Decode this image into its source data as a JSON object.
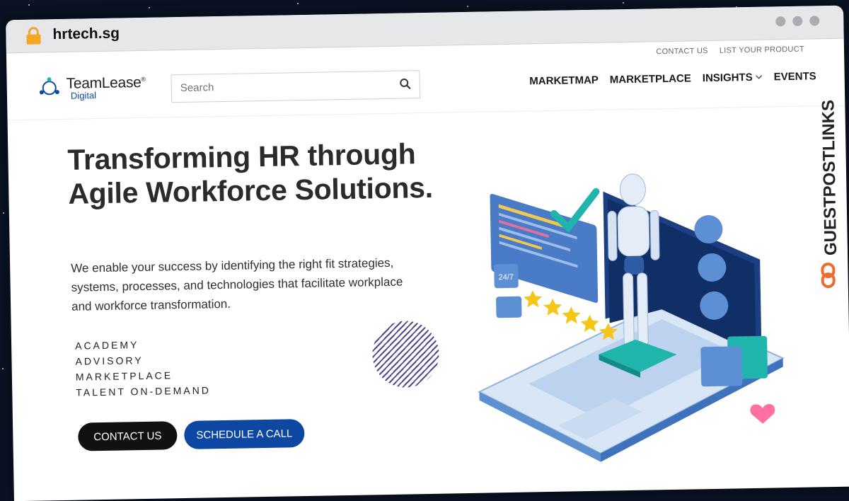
{
  "browser": {
    "url": "hrtech.sg"
  },
  "header": {
    "utility_links": [
      "CONTACT US",
      "LIST YOUR PRODUCT"
    ],
    "logo": {
      "name": "TeamLease",
      "reg": "®",
      "sub": "Digital"
    },
    "search": {
      "placeholder": "Search",
      "value": ""
    },
    "nav": [
      "MARKETMAP",
      "MARKETPLACE",
      "INSIGHTS",
      "EVENTS"
    ]
  },
  "hero": {
    "title": "Transforming HR through Agile Workforce Solutions.",
    "description": "We enable your success by identifying the right fit strategies, systems, processes, and technologies that facilitate workplace and workforce transformation.",
    "services": [
      "ACADEMY",
      "ADVISORY",
      "MARKETPLACE",
      "TALENT ON-DEMAND"
    ],
    "buttons": {
      "contact": "CONTACT US",
      "schedule": "SCHEDULE A CALL"
    },
    "illustration": {
      "badge_text": "24/7"
    }
  },
  "watermark": {
    "text": "GUESTPOSTLINKS"
  },
  "colors": {
    "primary_blue": "#0d47a1",
    "dark": "#111111",
    "accent_teal": "#1fb5ac",
    "brand_orange": "#f26a2b"
  }
}
